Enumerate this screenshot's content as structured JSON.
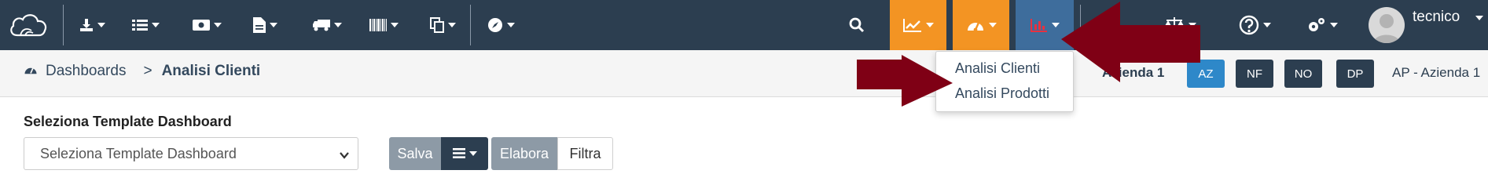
{
  "navbar": {
    "icons": [
      "cloud-logo-icon",
      "download-icon",
      "list-icon",
      "money-icon",
      "document-icon",
      "truck-icon",
      "barcode-icon",
      "copy-icon",
      "compass-icon",
      "search-icon",
      "line-chart-icon",
      "dashboard-gauge-icon",
      "bar-chart-icon",
      "balance-icon",
      "help-icon",
      "gears-icon",
      "user-avatar-icon"
    ],
    "user": "tecnico"
  },
  "breadcrumb": {
    "root": "Dashboards",
    "separator": ">",
    "current": "Analisi Clienti"
  },
  "dropdown": {
    "items": [
      "Analisi Clienti",
      "Analisi Prodotti"
    ]
  },
  "company": {
    "azienda_label": "Azienda 1",
    "buttons": [
      "AZ",
      "NF",
      "NO",
      "DP"
    ],
    "current": "AP - Azienda 1"
  },
  "template": {
    "label": "Seleziona Template Dashboard",
    "select_value": "Seleziona Template Dashboard"
  },
  "actions": {
    "salva": "Salva",
    "elabora": "Elabora",
    "filtra": "Filtra"
  },
  "colors": {
    "navbar": "#2c3e50",
    "orange": "#f39423",
    "blue": "#3e6d9c",
    "arrow": "#7f0015",
    "az": "#2e88c9"
  }
}
